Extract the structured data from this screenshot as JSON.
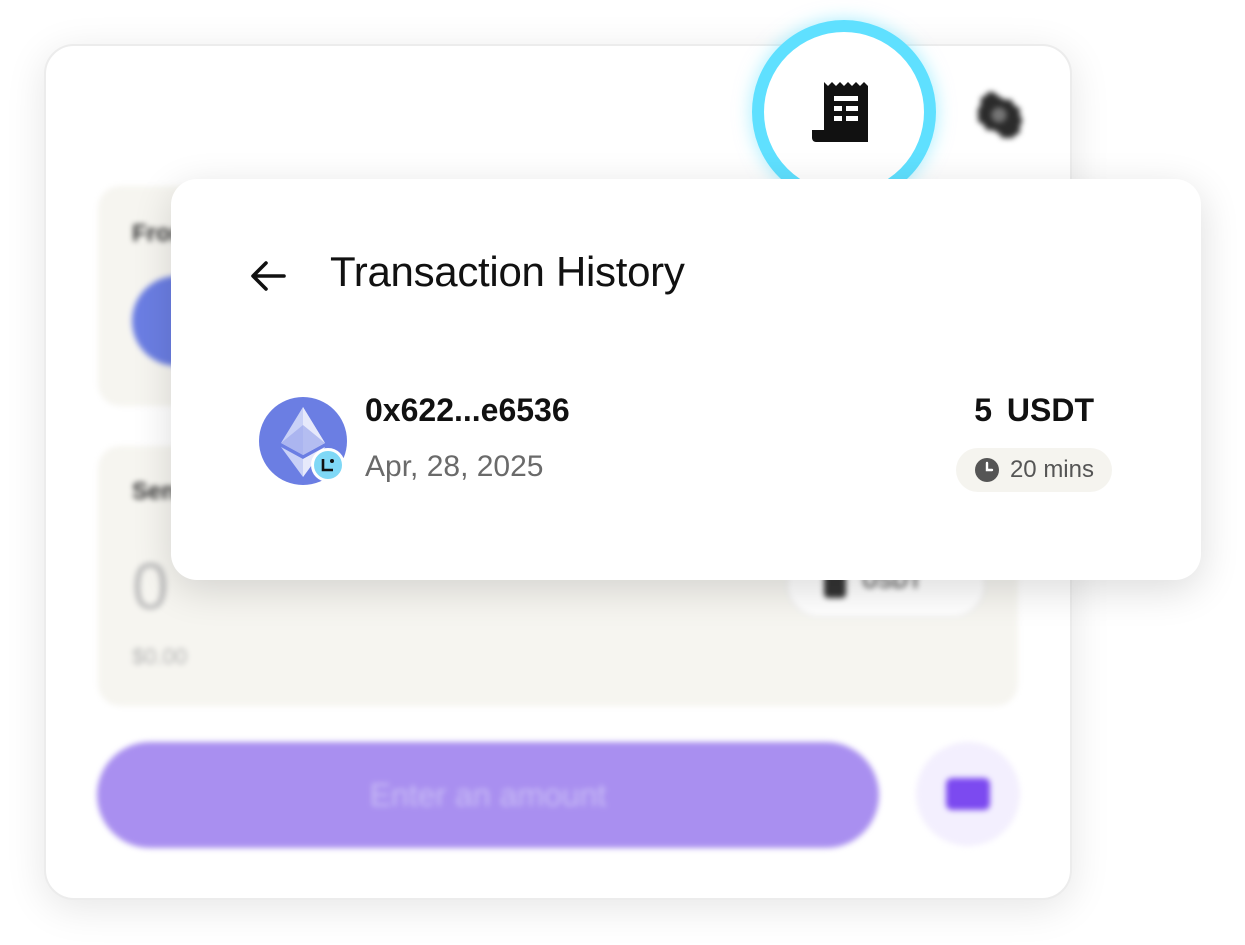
{
  "background_widget": {
    "from_label": "From",
    "send_label": "Send",
    "amount_value": "0",
    "usd_value": "$0.00",
    "token_symbol": "USDT",
    "action_button_label": "Enter an amount"
  },
  "toolbar": {
    "receipt_icon": "receipt-icon",
    "settings_icon": "gear-icon",
    "highlight_color": "#5fe0ff"
  },
  "history": {
    "title": "Transaction History",
    "back_icon": "arrow-left-icon",
    "transactions": [
      {
        "address": "0x622...e6536",
        "date": "Apr, 28, 2025",
        "amount": "5 USDT",
        "status_time": "20 mins",
        "token_icon": "ethereum-icon",
        "status_icon": "clock-icon"
      }
    ]
  },
  "colors": {
    "eth_purple": "#6b7ee3",
    "badge_cyan": "#7fd8f6",
    "action_purple": "#a98ff0",
    "panel_beige": "#f6f5f0"
  }
}
